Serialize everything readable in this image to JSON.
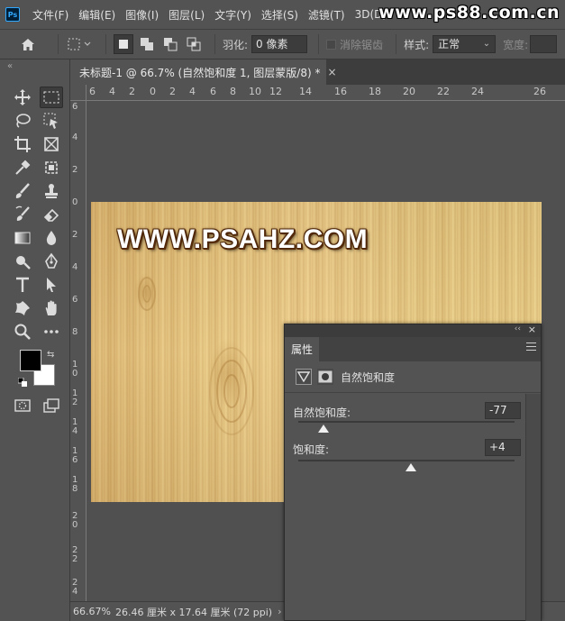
{
  "app": {
    "logo": "Ps",
    "watermark": "www.ps88.com.cn"
  },
  "menubar": {
    "items": [
      "文件(F)",
      "编辑(E)",
      "图像(I)",
      "图层(L)",
      "文字(Y)",
      "选择(S)",
      "滤镜(T)",
      "3D(D)"
    ]
  },
  "options": {
    "feather_label": "羽化:",
    "feather_value": "0 像素",
    "antialias_label": "消除锯齿",
    "style_label": "样式:",
    "style_value": "正常",
    "width_label": "宽度:"
  },
  "document": {
    "tab_title": "未标题-1 @ 66.7% (自然饱和度 1, 图层蒙版/8) *",
    "close": "×",
    "image_text": "WWW.PSAHZ.COM"
  },
  "rulers": {
    "horizontal": [
      "6",
      "4",
      "2",
      "0",
      "2",
      "4",
      "6",
      "8",
      "10",
      "12",
      "14",
      "16",
      "18",
      "20",
      "22",
      "24",
      "26"
    ],
    "vertical": [
      "6",
      "4",
      "2",
      "0",
      "2",
      "4",
      "6",
      "8",
      "10",
      "12",
      "14",
      "16",
      "18",
      "20",
      "22",
      "24"
    ]
  },
  "status": {
    "zoom": "66.67%",
    "info": "26.46 厘米 x 17.64 厘米 (72 ppi)",
    "arrow": "›"
  },
  "properties_panel": {
    "tab": "属性",
    "title": "自然饱和度",
    "vibrance_label": "自然饱和度:",
    "vibrance_value": "-77",
    "vibrance_level": -77,
    "saturation_label": "饱和度:",
    "saturation_value": "+4",
    "saturation_level": 4,
    "collapse": "‹‹",
    "close": "×"
  },
  "colors": {
    "foreground": "#000000",
    "background": "#ffffff",
    "accent": "#31a8ff"
  }
}
